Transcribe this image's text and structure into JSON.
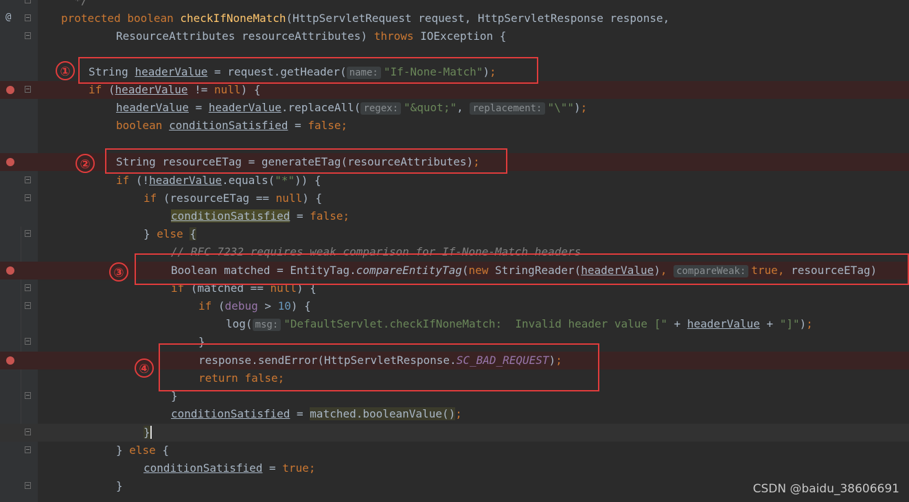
{
  "editor": {
    "language": "java",
    "gutter_marks": {
      "at_line": "@"
    },
    "lines": [
      {
        "id": "l0",
        "text": "  */"
      },
      {
        "id": "l1",
        "text": "protected boolean checkIfNoneMatch(HttpServletRequest request, HttpServletResponse response,"
      },
      {
        "id": "l2",
        "text": "        ResourceAttributes resourceAttributes) throws IOException {"
      },
      {
        "id": "l3",
        "text": ""
      },
      {
        "id": "l4",
        "text": "    String headerValue = request.getHeader(name: \"If-None-Match\");"
      },
      {
        "id": "l5",
        "text": "    if (headerValue != null) {"
      },
      {
        "id": "l6",
        "text": "        headerValue = headerValue.replaceAll(regex: \"&quot;\", replacement: \"\\\"\");"
      },
      {
        "id": "l7",
        "text": "        boolean conditionSatisfied = false;"
      },
      {
        "id": "l8",
        "text": ""
      },
      {
        "id": "l9",
        "text": "        String resourceETag = generateETag(resourceAttributes);"
      },
      {
        "id": "l10",
        "text": "        if (!headerValue.equals(\"*\")) {"
      },
      {
        "id": "l11",
        "text": "            if (resourceETag == null) {"
      },
      {
        "id": "l12",
        "text": "                conditionSatisfied = false;"
      },
      {
        "id": "l13",
        "text": "            } else {"
      },
      {
        "id": "l14",
        "text": "                // RFC 7232 requires weak comparison for If-None-Match headers"
      },
      {
        "id": "l15",
        "text": "                Boolean matched = EntityTag.compareEntityTag(new StringReader(headerValue), compareWeak: true, resourceETag)"
      },
      {
        "id": "l16",
        "text": "                if (matched == null) {"
      },
      {
        "id": "l17",
        "text": "                    if (debug > 10) {"
      },
      {
        "id": "l18",
        "text": "                        log( msg: \"DefaultServlet.checkIfNoneMatch:  Invalid header value [\" + headerValue + \"]\");"
      },
      {
        "id": "l19",
        "text": "                    }"
      },
      {
        "id": "l20",
        "text": "                    response.sendError(HttpServletResponse.SC_BAD_REQUEST);"
      },
      {
        "id": "l21",
        "text": "                    return false;"
      },
      {
        "id": "l22",
        "text": "                }"
      },
      {
        "id": "l23",
        "text": "                conditionSatisfied = matched.booleanValue();"
      },
      {
        "id": "l24",
        "text": "            }"
      },
      {
        "id": "l25",
        "text": "        } else {"
      },
      {
        "id": "l26",
        "text": "            conditionSatisfied = true;"
      },
      {
        "id": "l27",
        "text": "        }"
      }
    ],
    "breakpoint_lines": [
      "l5",
      "l9",
      "l15",
      "l20"
    ],
    "current_line": "l24"
  },
  "annotations": [
    {
      "label": "①",
      "target": "l4"
    },
    {
      "label": "②",
      "target": "l9"
    },
    {
      "label": "③",
      "target": "l15"
    },
    {
      "label": "④",
      "target": "l20-l21"
    }
  ],
  "watermark": {
    "text": "CSDN @baidu_38606691"
  },
  "colors": {
    "background": "#2b2b2b",
    "keyword": "#cc7832",
    "string": "#6a8759",
    "method": "#ffc66d",
    "field": "#9876aa",
    "comment": "#808080",
    "breakpoint": "#c75450",
    "annotation_red": "#e03c3c"
  }
}
